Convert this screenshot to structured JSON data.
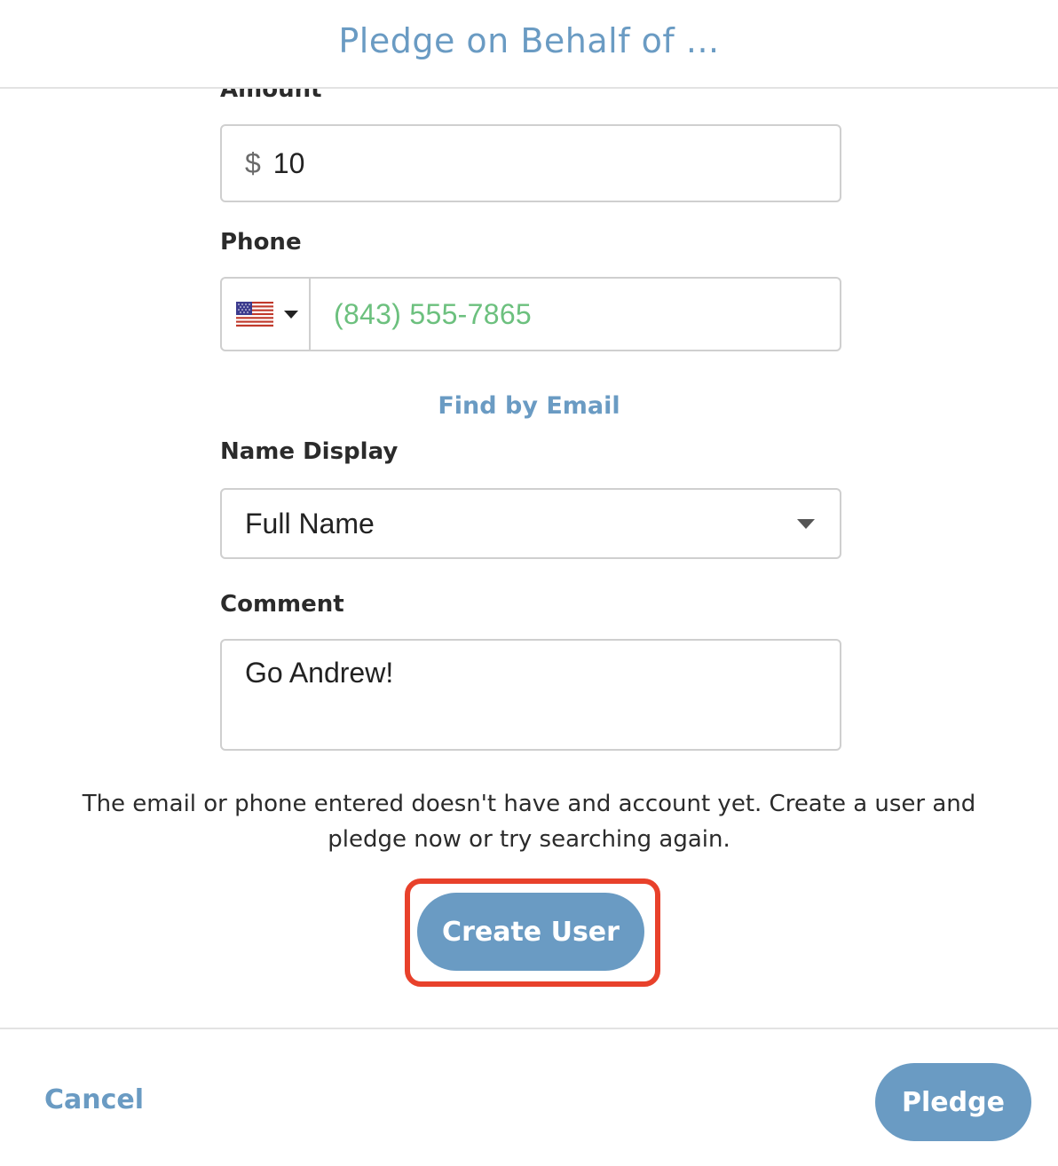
{
  "header": {
    "title": "Pledge on Behalf of ..."
  },
  "form": {
    "amount": {
      "label": "Amount",
      "currency_symbol": "$",
      "value": "10"
    },
    "phone": {
      "label": "Phone",
      "country_icon": "us-flag-icon",
      "value": "(843) 555-7865"
    },
    "find_by_email_label": "Find by Email",
    "name_display": {
      "label": "Name Display",
      "selected": "Full Name"
    },
    "comment": {
      "label": "Comment",
      "value": "Go Andrew!"
    }
  },
  "notice": {
    "text": "The email or phone entered doesn't have and account yet. Create a user and pledge now or try searching again."
  },
  "create_user_label": "Create User",
  "footer": {
    "cancel_label": "Cancel",
    "pledge_label": "Pledge"
  },
  "colors": {
    "accent": "#6a9bc3",
    "phone_text": "#6cc07e",
    "highlight": "#e8412b"
  }
}
